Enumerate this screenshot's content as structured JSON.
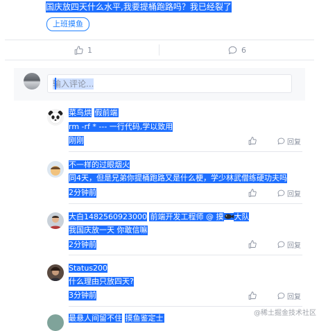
{
  "post": {
    "text": "国庆放四天什么水平,我要提桶跑路吗？我已经裂了",
    "tag": "上班摸鱼"
  },
  "actions": {
    "like_count": "1",
    "comment_count": "6"
  },
  "input": {
    "placeholder": "输入评论..."
  },
  "comments": [
    {
      "user": "菜鸟烘",
      "title": "假前端",
      "text": "rm -rf * --- 一行代码,学以致用",
      "time": "刚刚",
      "reply": "回复"
    },
    {
      "user": "不一样的过眼烟火",
      "title": "",
      "text": "同4天，但是兄弟你提桶跑路又是什么梗，学少林武僧练硬功夫吗",
      "time": "2分钟前",
      "reply": "回复"
    },
    {
      "user": "大白1482560923000",
      "title": "前端开发工程师 @ 摸",
      "title_suffix": "大队",
      "text": "我国庆放一天 你敢信嘛",
      "time": "2分钟前",
      "reply": "回复"
    },
    {
      "user": "Status200",
      "title": "",
      "text": "什么理由只放四天?",
      "time": "3分钟前",
      "reply": "回复"
    },
    {
      "user": "最悬人间留不住",
      "title": "摸鱼鉴定士",
      "text": "",
      "time": "",
      "reply": ""
    }
  ],
  "watermark": "@稀土掘金技术社区"
}
